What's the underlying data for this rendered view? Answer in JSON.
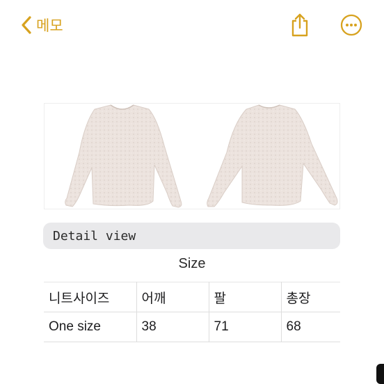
{
  "nav": {
    "back_label": "메모",
    "back_icon": "chevron-left-icon",
    "share_icon": "share-icon",
    "more_icon": "ellipsis-circle-icon",
    "accent_color": "#d7a21f"
  },
  "photo": {
    "description_icon": "sweater-photo",
    "garment_color": "#ece3de"
  },
  "detail": {
    "text": "Detail view"
  },
  "size_section": {
    "title": "Size",
    "headers": [
      "니트사이즈",
      "어깨",
      "팔",
      "총장"
    ],
    "rows": [
      [
        "One size",
        "38",
        "71",
        "68"
      ]
    ]
  }
}
